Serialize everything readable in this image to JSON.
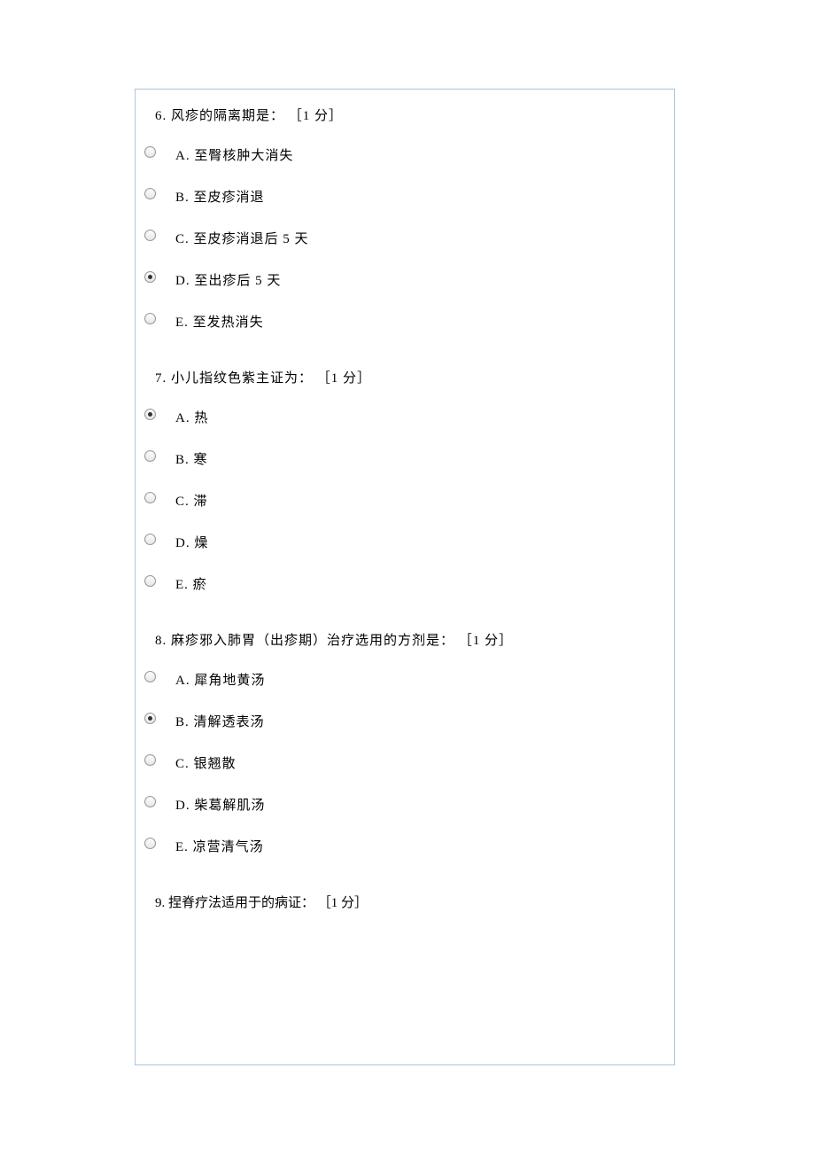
{
  "questions": [
    {
      "number": "6.",
      "title": "风疹的隔离期是：",
      "points": "［1 分］",
      "selected": 3,
      "options": [
        {
          "letter": "A.",
          "text": "至臀核肿大消失"
        },
        {
          "letter": "B.",
          "text": "至皮疹消退"
        },
        {
          "letter": "C.",
          "text": "至皮疹消退后 5 天"
        },
        {
          "letter": "D.",
          "text": "至出疹后 5 天"
        },
        {
          "letter": "E.",
          "text": "至发热消失"
        }
      ]
    },
    {
      "number": "7.",
      "title": "小儿指纹色紫主证为：",
      "points": "［1 分］",
      "selected": 0,
      "options": [
        {
          "letter": "A.",
          "text": "热"
        },
        {
          "letter": "B.",
          "text": "寒"
        },
        {
          "letter": "C.",
          "text": "滞"
        },
        {
          "letter": "D.",
          "text": "燥"
        },
        {
          "letter": "E.",
          "text": "瘀"
        }
      ]
    },
    {
      "number": "8.",
      "title": "麻疹邪入肺胃（出疹期）治疗选用的方剂是：",
      "points": "［1 分］",
      "selected": 1,
      "options": [
        {
          "letter": "A.",
          "text": "犀角地黄汤"
        },
        {
          "letter": "B.",
          "text": "清解透表汤"
        },
        {
          "letter": "C.",
          "text": "银翘散"
        },
        {
          "letter": "D.",
          "text": "柴葛解肌汤"
        },
        {
          "letter": "E.",
          "text": "凉营清气汤"
        }
      ]
    }
  ],
  "lastQuestion": {
    "number": "9.",
    "title": "捏脊疗法适用于的病证：",
    "points": "［1 分］"
  }
}
